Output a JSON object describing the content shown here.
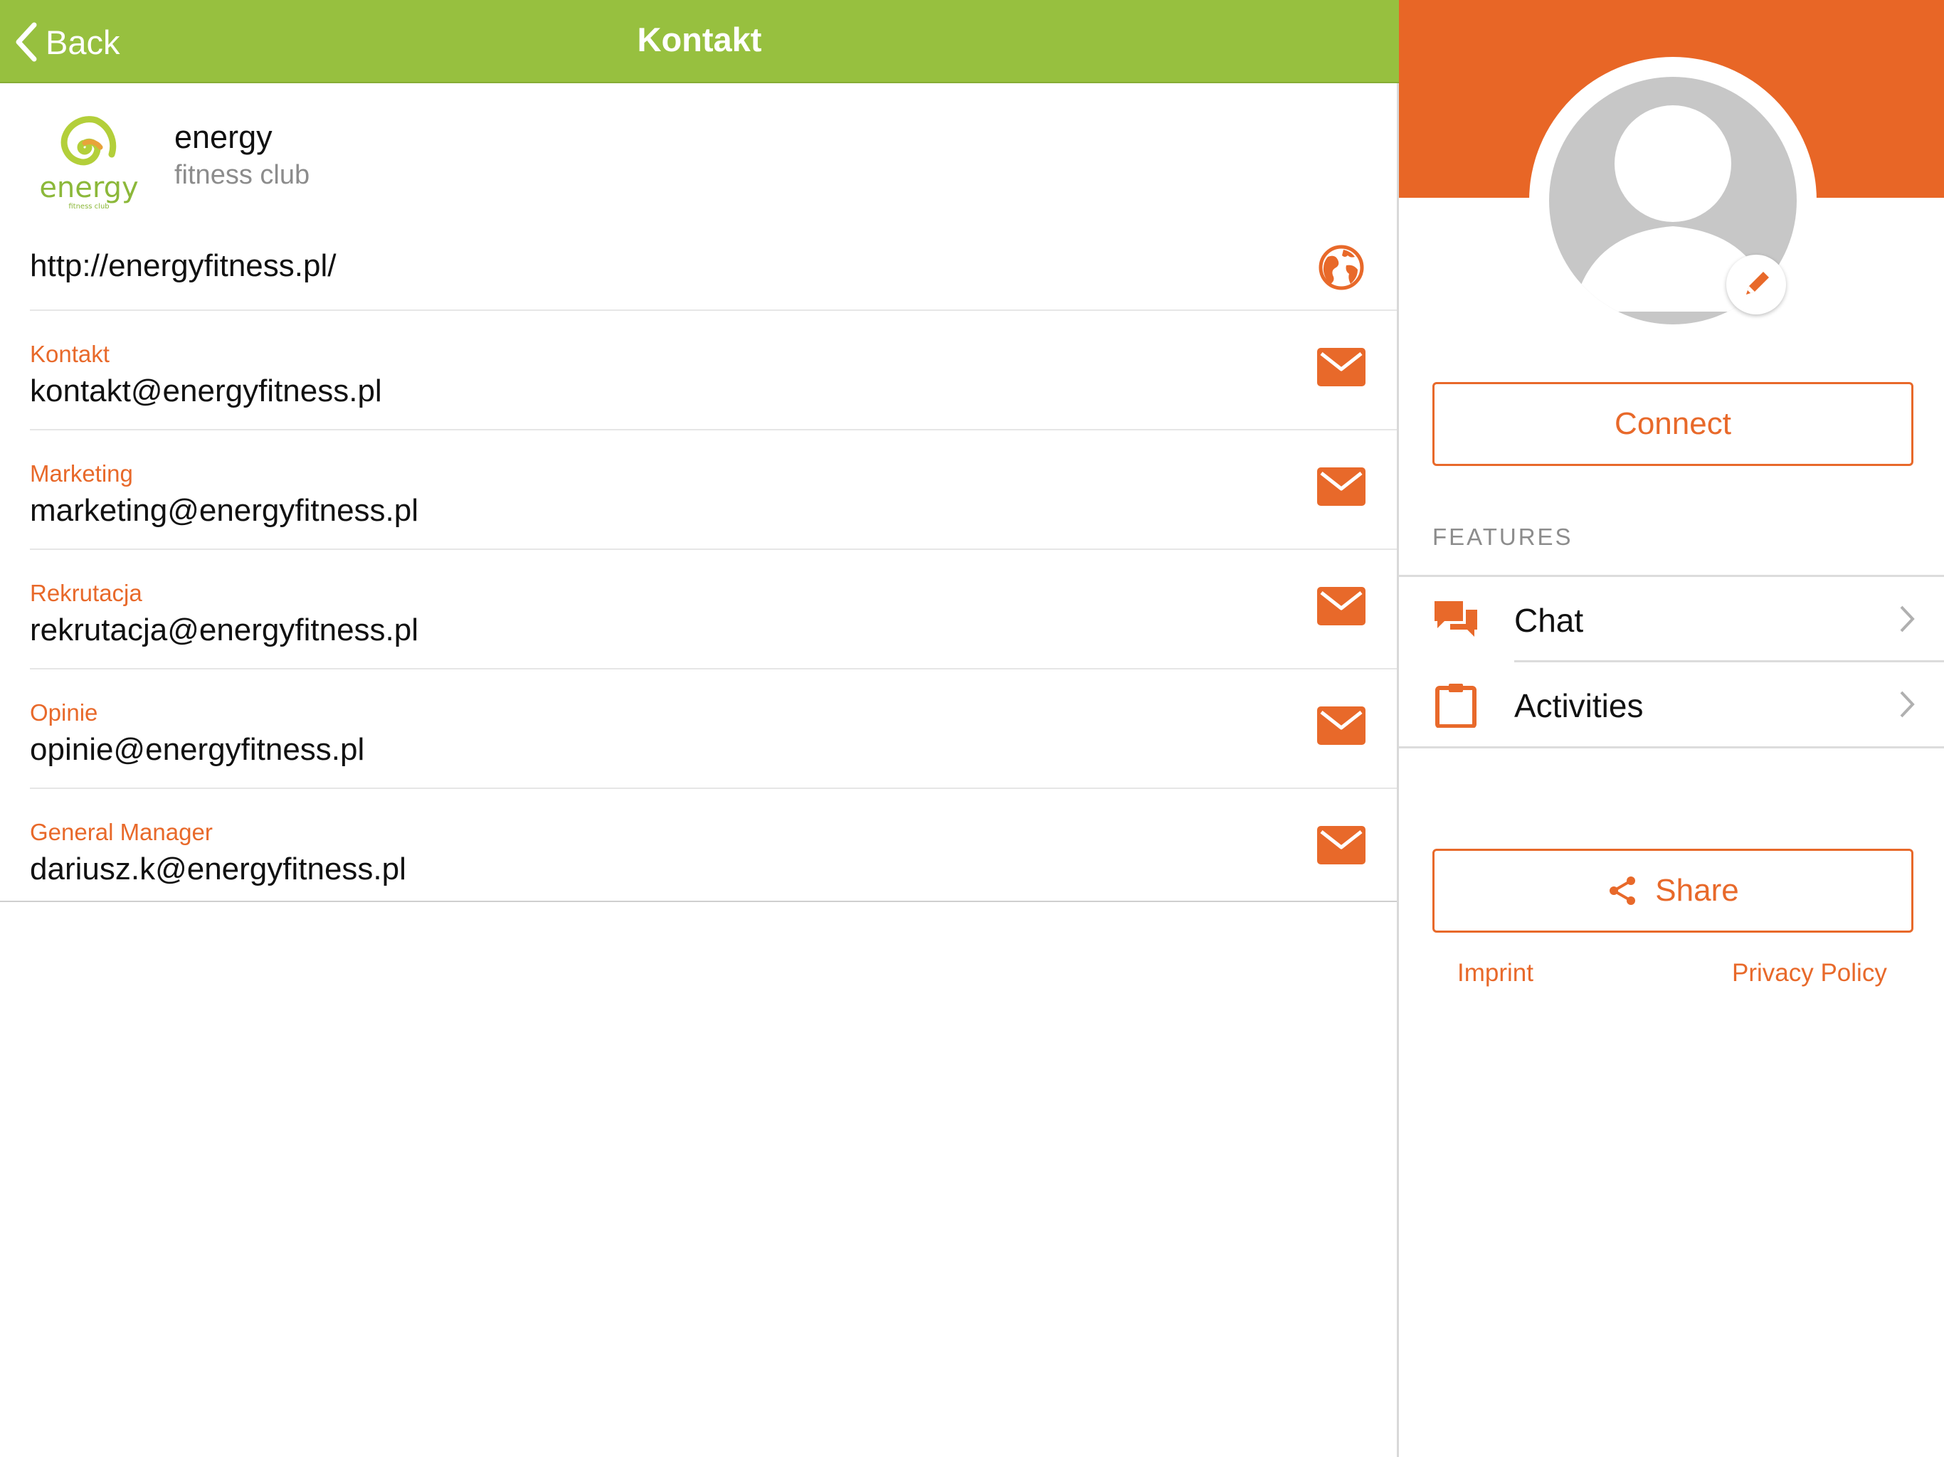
{
  "navbar": {
    "back_label": "Back",
    "title": "Kontakt"
  },
  "organization": {
    "name": "energy",
    "subtitle": "fitness club",
    "logo_text": "energy",
    "logo_small_text": "fitness club"
  },
  "website": {
    "url": "http://energyfitness.pl/"
  },
  "contacts": [
    {
      "label": "Kontakt",
      "email": "kontakt@energyfitness.pl"
    },
    {
      "label": "Marketing",
      "email": "marketing@energyfitness.pl"
    },
    {
      "label": "Rekrutacja",
      "email": "rekrutacja@energyfitness.pl"
    },
    {
      "label": "Opinie",
      "email": "opinie@energyfitness.pl"
    },
    {
      "label": "General Manager",
      "email": "dariusz.k@energyfitness.pl"
    }
  ],
  "profile": {
    "connect_label": "Connect",
    "features_label": "FEATURES",
    "features": [
      {
        "label": "Chat",
        "icon": "chat-icon"
      },
      {
        "label": "Activities",
        "icon": "clipboard-icon"
      }
    ],
    "share_label": "Share",
    "imprint_label": "Imprint",
    "privacy_label": "Privacy Policy"
  },
  "colors": {
    "nav_green": "#97c03f",
    "accent_orange": "#e8692a",
    "banner_orange": "#e86626"
  }
}
